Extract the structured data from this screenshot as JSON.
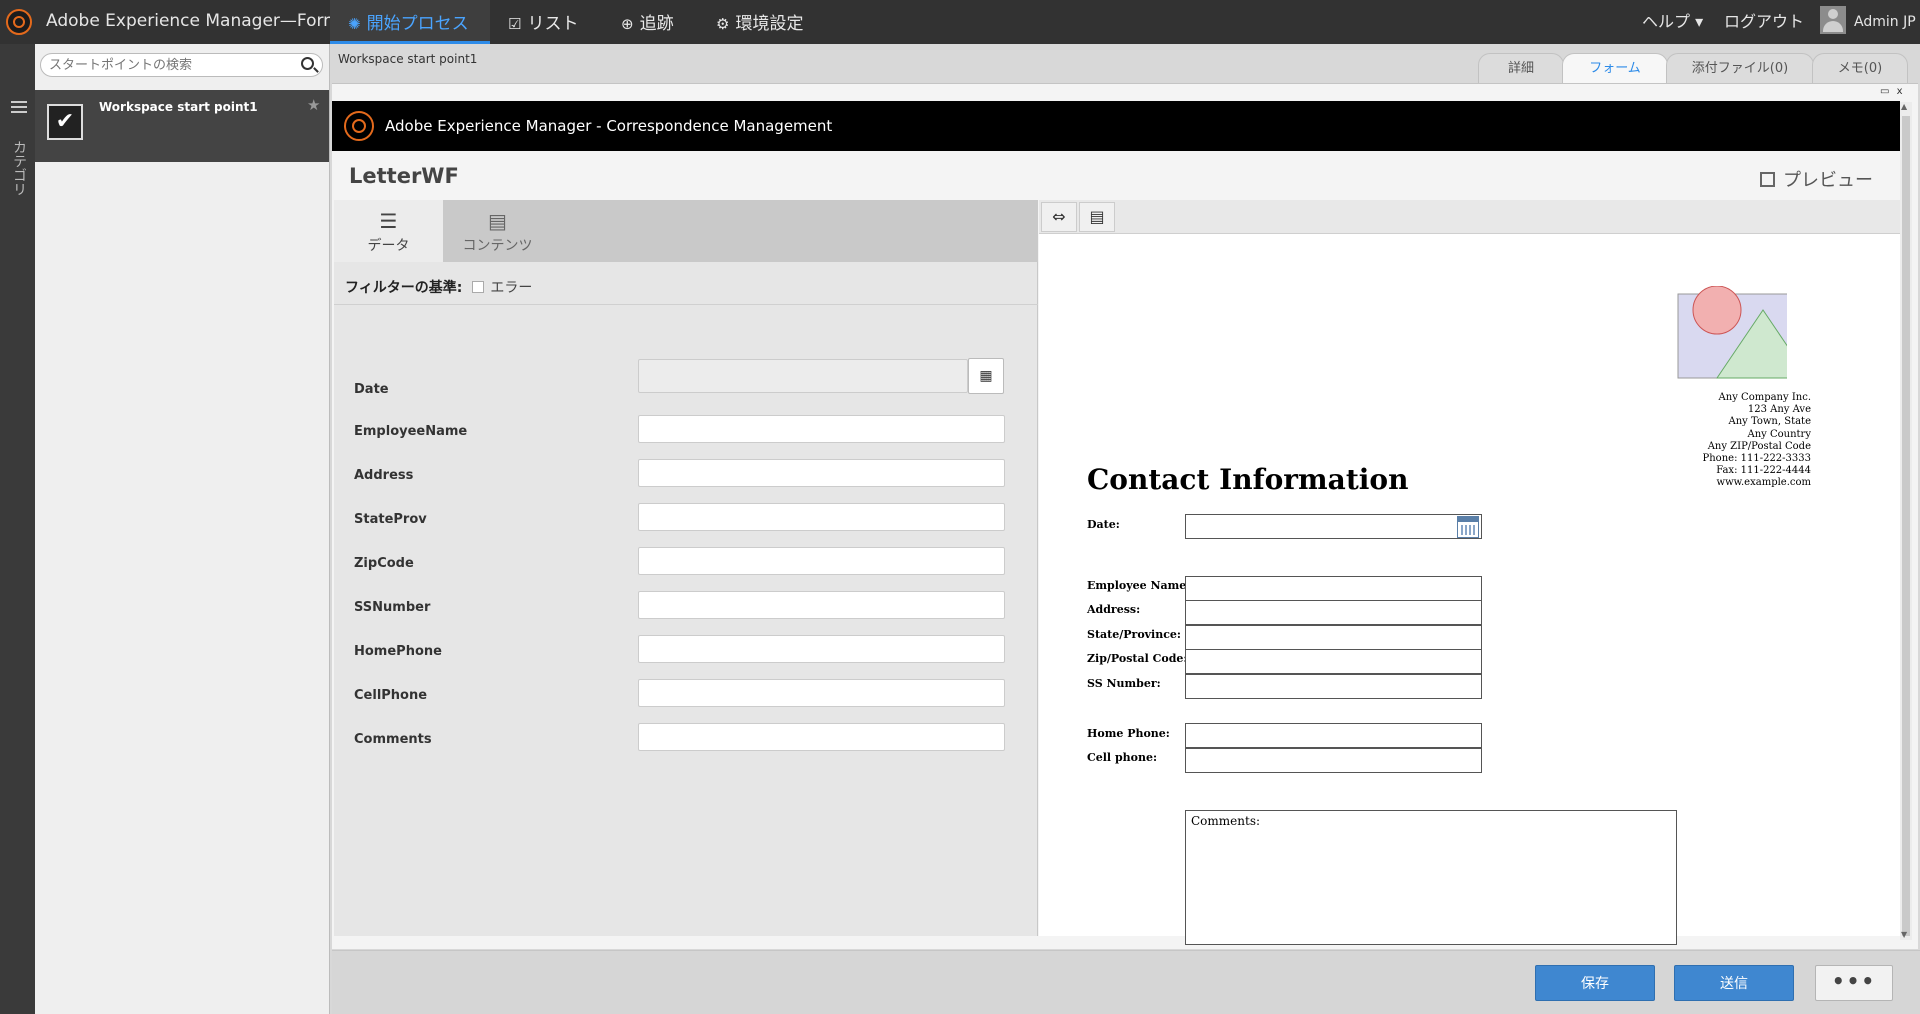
{
  "app": {
    "title": "Adobe Experience Manager—Forms"
  },
  "nav": {
    "start": {
      "label": "開始プロセス"
    },
    "list": {
      "label": "リスト"
    },
    "track": {
      "label": "追跡"
    },
    "prefs": {
      "label": "環境設定"
    }
  },
  "header_right": {
    "help": "ヘルプ ▾",
    "logout": "ログアウト",
    "user": "Admin JP"
  },
  "rail": {
    "label": "カテゴリ"
  },
  "startpoints": {
    "search_placeholder": "スタートポイントの検索",
    "items": [
      {
        "label": "Workspace start point1"
      }
    ]
  },
  "breadcrumb": "Workspace start point1",
  "right_tabs": [
    "詳細",
    "フォーム",
    "添付ファイル(0)",
    "メモ(0)"
  ],
  "active_right_tab": "フォーム",
  "window_controls": "▭ x",
  "cm": {
    "title": "Adobe Experience Manager - Correspondence Management"
  },
  "letter": {
    "title": "LetterWF",
    "preview_label": "プレビュー"
  },
  "panel_tabs": [
    {
      "label": "データ",
      "icon": "data-icon"
    },
    {
      "label": "コンテンツ",
      "icon": "content-icon"
    }
  ],
  "filter": {
    "label": "フィルターの基準:",
    "option": "エラー"
  },
  "fields": [
    {
      "label": "Date",
      "value": ""
    },
    {
      "label": "EmployeeName",
      "value": ""
    },
    {
      "label": "Address",
      "value": ""
    },
    {
      "label": "StateProv",
      "value": ""
    },
    {
      "label": "ZipCode",
      "value": ""
    },
    {
      "label": "SSNumber",
      "value": ""
    },
    {
      "label": "HomePhone",
      "value": ""
    },
    {
      "label": "CellPhone",
      "value": ""
    },
    {
      "label": "Comments",
      "value": ""
    }
  ],
  "doc": {
    "address_lines": [
      "Any Company Inc.",
      "123 Any Ave",
      "Any Town, State",
      "Any Country",
      "Any ZIP/Postal Code",
      "Phone: 111-222-3333",
      "Fax: 111-222-4444",
      "www.example.com"
    ],
    "title": "Contact Information",
    "labels": {
      "date": "Date:",
      "employee": "Employee Name:",
      "address": "Address:",
      "state": "State/Province:",
      "zip": "Zip/Postal Code:",
      "ss": "SS Number:",
      "home": "Home Phone:",
      "cell": "Cell phone:"
    },
    "comments_label": "Comments:"
  },
  "buttons": {
    "save": "保存",
    "submit": "送信",
    "more": "•••"
  },
  "colors": {
    "accent": "#2d8be8",
    "brand": "#e46a1c",
    "primary_button": "#3f87d0"
  }
}
